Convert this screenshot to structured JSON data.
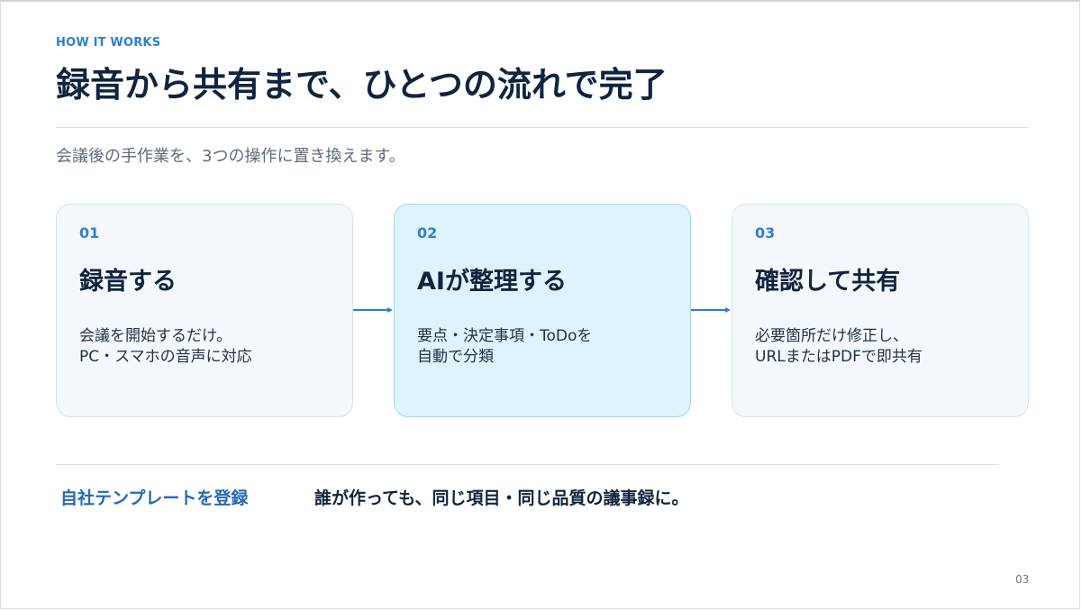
{
  "slide": {
    "eyebrow": "HOW IT WORKS",
    "title": "録音から共有まで、ひとつの流れで完了",
    "subtitle": "会議後の手作業を、3つの操作に置き換えます。",
    "steps": [
      {
        "number": "01",
        "title": "録音する",
        "desc_line1": "会議を開始するだけ。",
        "desc_line2": "PC・スマホの音声に対応"
      },
      {
        "number": "02",
        "title": "AIが整理する",
        "desc_line1": "要点・決定事項・ToDoを",
        "desc_line2": "自動で分類"
      },
      {
        "number": "03",
        "title": "確認して共有",
        "desc_line1": "必要箇所だけ修正し、",
        "desc_line2": "URLまたはPDFで即共有"
      }
    ],
    "template_label": "自社テンプレートを登録",
    "template_message": "誰が作っても、同じ項目・同じ品質の議事録に。",
    "page_number": "03"
  },
  "colors": {
    "accent": "#2f7fd3",
    "title": "#10243f",
    "highlight_card": "#ddf3fd",
    "card": "#f4f7fb"
  },
  "icons": {
    "step_connector": "arrow-right-icon"
  }
}
